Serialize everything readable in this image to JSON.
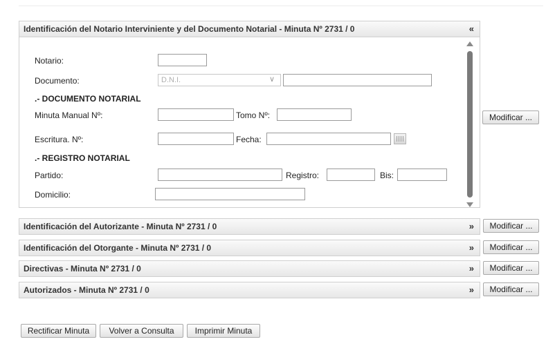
{
  "panels": {
    "notario": {
      "title": "Identificación del Notario Interviniente y del Documento Notarial - Minuta Nº 2731 / 0",
      "toggle": "«"
    },
    "autorizante": {
      "title": "Identificación del Autorizante - Minuta Nº 2731 / 0",
      "toggle": "»"
    },
    "otorgante": {
      "title": "Identificación del Otorgante - Minuta Nº 2731 / 0",
      "toggle": "»"
    },
    "directivas": {
      "title": "Directivas - Minuta Nº 2731 / 0",
      "toggle": "»"
    },
    "autorizados": {
      "title": "Autorizados - Minuta Nº 2731 / 0",
      "toggle": "»"
    }
  },
  "form": {
    "notario_label": "Notario:",
    "documento_label": "Documento:",
    "documento_type": "D.N.I.",
    "section_documento": ".- DOCUMENTO NOTARIAL",
    "minuta_label": "Minuta Manual Nº:",
    "tomo_label": "Tomo Nº:",
    "escritura_label": "Escritura. Nº:",
    "fecha_label": "Fecha:",
    "section_registro": ".- REGISTRO NOTARIAL",
    "partido_label": "Partido:",
    "registro_label": "Registro:",
    "bis_label": "Bis:",
    "domicilio_label": "Domicilio:"
  },
  "buttons": {
    "modificar": "Modificar ...",
    "rectificar": "Rectificar Minuta",
    "volver": "Volver a Consulta",
    "imprimir": "Imprimir Minuta"
  }
}
